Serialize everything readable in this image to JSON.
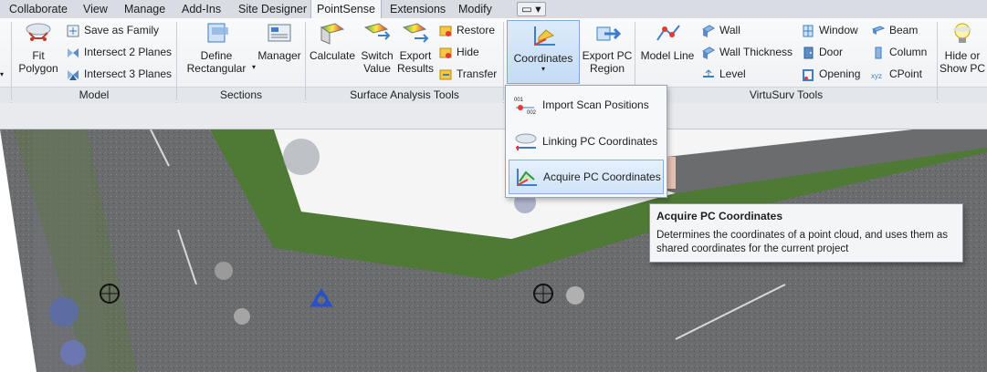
{
  "tabs": [
    {
      "label": "Collaborate"
    },
    {
      "label": "View"
    },
    {
      "label": "Manage"
    },
    {
      "label": "Add-Ins"
    },
    {
      "label": "Site Designer"
    },
    {
      "label": "PointSense"
    },
    {
      "label": "Extensions"
    },
    {
      "label": "Modify"
    }
  ],
  "active_tab": "PointSense",
  "ribbon": {
    "model": {
      "group_label": "Model",
      "fit_polygon": "Fit Polygon",
      "save_as_family": "Save as Family",
      "intersect_2": "Intersect 2 Planes",
      "intersect_3": "Intersect 3 Planes"
    },
    "sections": {
      "group_label": "Sections",
      "define_rectangular": "Define Rectangular",
      "manager": "Manager"
    },
    "surface": {
      "group_label": "Surface Analysis Tools",
      "calculate": "Calculate",
      "switch_value": "Switch Value",
      "export_results": "Export Results",
      "restore": "Restore",
      "hide": "Hide",
      "transfer": "Transfer"
    },
    "coordinates": {
      "label": "Coordinates"
    },
    "export_pc_region": "Export PC Region",
    "virtusurv": {
      "group_label": "VirtuSurv Tools",
      "model_line": "Model Line",
      "wall": "Wall",
      "wall_thickness": "Wall Thickness",
      "level": "Level",
      "window": "Window",
      "door": "Door",
      "opening": "Opening",
      "beam": "Beam",
      "column": "Column",
      "cpoint": "CPoint",
      "hide_or_show_pc": "Hide or Show PC"
    }
  },
  "dropdown": {
    "items": [
      {
        "label": "Import Scan Positions"
      },
      {
        "label": "Linking PC Coordinates"
      },
      {
        "label": "Acquire PC Coordinates"
      }
    ]
  },
  "tooltip": {
    "title": "Acquire PC Coordinates",
    "description": "Determines the coordinates of a point cloud, and uses them as shared coordinates for the current project"
  },
  "colors": {
    "accent": "#3c7fc8",
    "ribbon_bg": "#f3f4f6",
    "highlight": "#cfe3f8"
  }
}
